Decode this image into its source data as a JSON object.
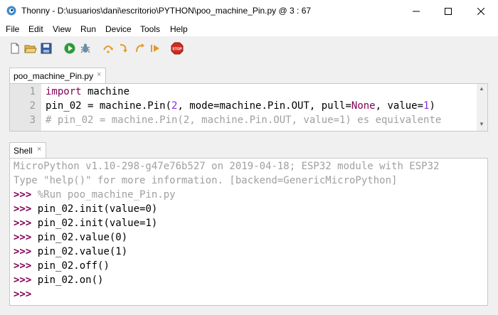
{
  "window": {
    "title": "Thonny  -  D:\\usuarios\\dani\\escritorio\\PYTHON\\poo_machine_Pin.py  @  3 : 67"
  },
  "menu": {
    "items": [
      "File",
      "Edit",
      "View",
      "Run",
      "Device",
      "Tools",
      "Help"
    ]
  },
  "toolbar": {
    "icons": [
      "new-file-icon",
      "open-file-icon",
      "save-file-icon",
      "run-icon",
      "debug-icon",
      "step-over-icon",
      "step-into-icon",
      "step-out-icon",
      "resume-icon",
      "stop-icon"
    ],
    "stop_label": "STOP"
  },
  "editor": {
    "tab_label": "poo_machine_Pin.py",
    "tab_close": "×",
    "line_numbers": [
      "1",
      "2",
      "3"
    ],
    "lines": {
      "l1_kw": "import",
      "l1_rest": " machine",
      "l2_a": "pin_02 = machine.Pin(",
      "l2_num1": "2",
      "l2_b": ", mode=machine.Pin.OUT, pull=",
      "l2_none": "None",
      "l2_c": ", value=",
      "l2_num2": "1",
      "l2_d": ")",
      "l3_comment": "# pin_02 = machine.Pin(2, machine.Pin.OUT, value=1) es equivalente"
    }
  },
  "shell": {
    "tab_label": "Shell",
    "tab_close": "×",
    "banner1": "MicroPython v1.10-298-g47e76b527 on 2019-04-18; ESP32 module with ESP32",
    "banner2": "Type \"help()\" for more information. [backend=GenericMicroPython]",
    "prompt": ">>>",
    "run_command": " %Run poo_machine_Pin.py",
    "commands": [
      " pin_02.init(value=0)",
      " pin_02.init(value=1)",
      " pin_02.value(0)",
      " pin_02.value(1)",
      " pin_02.off()",
      " pin_02.on()"
    ]
  }
}
